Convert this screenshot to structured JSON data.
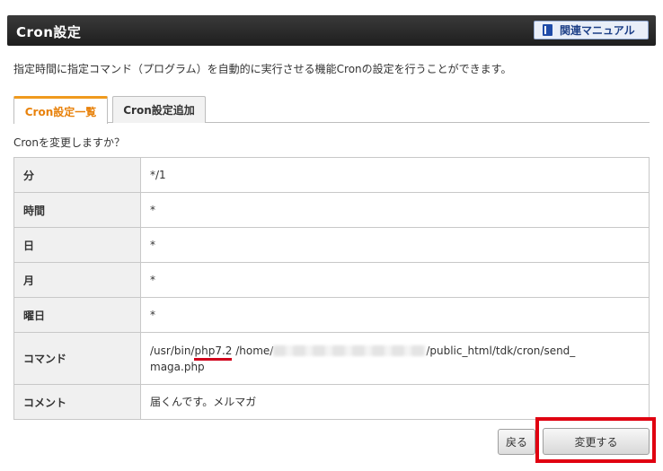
{
  "header": {
    "title": "Cron設定",
    "manual_button": "関連マニュアル"
  },
  "description": "指定時間に指定コマンド（プログラム）を自動的に実行させる機能Cronの設定を行うことができます。",
  "tabs": [
    {
      "label": "Cron設定一覧",
      "active": true
    },
    {
      "label": "Cron設定追加",
      "active": false
    }
  ],
  "question": "Cronを変更しますか？",
  "fields": {
    "minute": {
      "label": "分",
      "value": "*/1"
    },
    "hour": {
      "label": "時間",
      "value": "*"
    },
    "day": {
      "label": "日",
      "value": "*"
    },
    "month": {
      "label": "月",
      "value": "*"
    },
    "weekday": {
      "label": "曜日",
      "value": "*"
    },
    "command": {
      "label": "コマンド",
      "prefix": "/usr/bin/",
      "php": "php7.2",
      "home": " /home/",
      "suffix": "/public_html/tdk/cron/send_",
      "line2": "maga.php"
    },
    "comment": {
      "label": "コメント",
      "value": "届くんです。メルマガ"
    }
  },
  "buttons": {
    "back": "戻る",
    "submit": "変更する"
  },
  "colors": {
    "accent_tab": "#e8820c",
    "highlight": "#e00010",
    "underline": "#d0021b"
  }
}
